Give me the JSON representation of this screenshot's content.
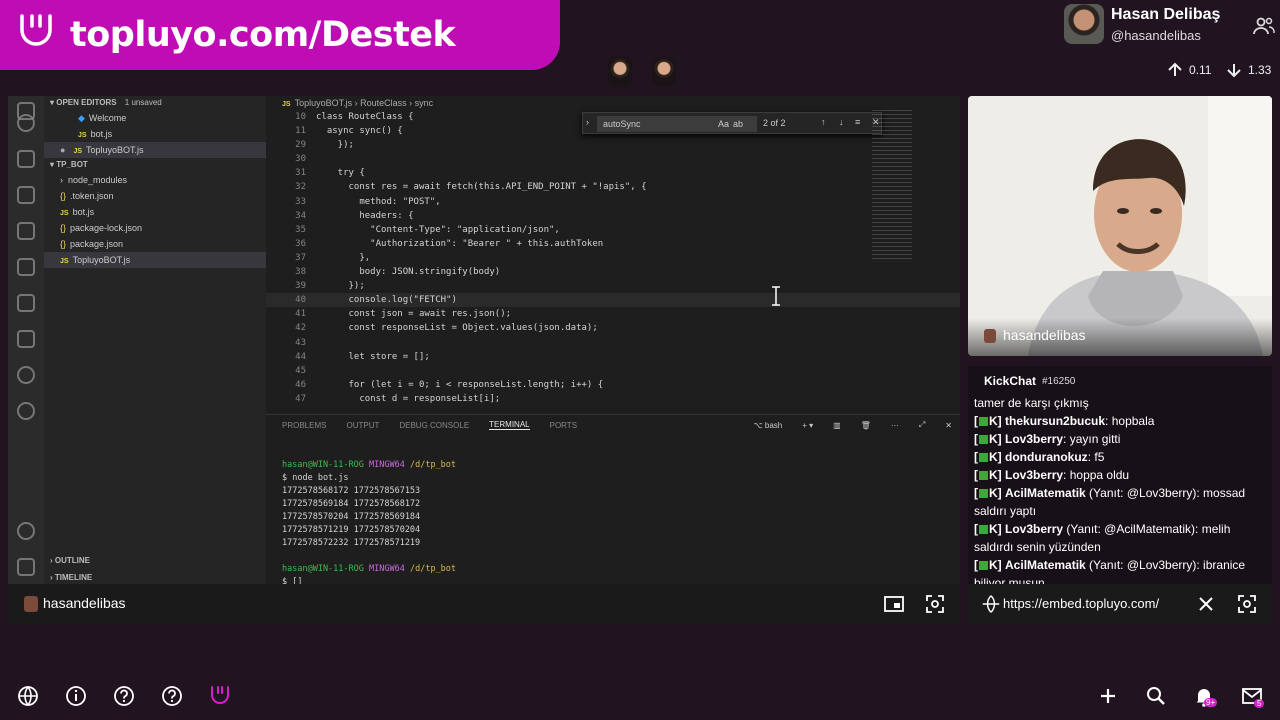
{
  "banner": {
    "text": "topluyo.com/Destek",
    "color": "#c00cb4"
  },
  "profile": {
    "name": "Hasan Delibaş",
    "handle": "@hasandelibas",
    "up": "0.11",
    "down": "1.33"
  },
  "vscode": {
    "explorer": {
      "open_editors_label": "OPEN EDITORS",
      "unsaved": "1 unsaved",
      "open_items": [
        "Welcome",
        "bot.js",
        "TopluyoBOT.js"
      ],
      "folder": "TP_BOT",
      "files": [
        "node_modules",
        ".token.json",
        "bot.js",
        "package-lock.json",
        "package.json",
        "TopluyoBOT.js"
      ],
      "outline": "OUTLINE",
      "timeline": "TIMELINE"
    },
    "breadcrumb": [
      "TopluyoBOT.js",
      "RouteClass",
      "sync"
    ],
    "find": {
      "query": "autoSync",
      "case": "Aa",
      "word": "ab",
      "count": "2 of 2"
    },
    "code": [
      {
        "n": "10",
        "t": "class RouteClass {"
      },
      {
        "n": "11",
        "t": "  async sync() {"
      },
      {
        "n": "29",
        "t": "    });"
      },
      {
        "n": "30",
        "t": ""
      },
      {
        "n": "31",
        "t": "    try {"
      },
      {
        "n": "32",
        "t": "      const res = await fetch(this.API_END_POINT + \"!apis\", {"
      },
      {
        "n": "33",
        "t": "        method: \"POST\","
      },
      {
        "n": "34",
        "t": "        headers: {"
      },
      {
        "n": "35",
        "t": "          \"Content-Type\": \"application/json\","
      },
      {
        "n": "36",
        "t": "          \"Authorization\": \"Bearer \" + this.authToken"
      },
      {
        "n": "37",
        "t": "        },"
      },
      {
        "n": "38",
        "t": "        body: JSON.stringify(body)"
      },
      {
        "n": "39",
        "t": "      });"
      },
      {
        "n": "40",
        "t": "      console.log(\"FETCH\")"
      },
      {
        "n": "41",
        "t": "      const json = await res.json();"
      },
      {
        "n": "42",
        "t": "      const responseList = Object.values(json.data);"
      },
      {
        "n": "43",
        "t": ""
      },
      {
        "n": "44",
        "t": "      let store = [];"
      },
      {
        "n": "45",
        "t": ""
      },
      {
        "n": "46",
        "t": "      for (let i = 0; i < responseList.length; i++) {"
      },
      {
        "n": "47",
        "t": "        const d = responseList[i];"
      }
    ],
    "panel_tabs": [
      "PROBLEMS",
      "OUTPUT",
      "DEBUG CONSOLE",
      "TERMINAL",
      "PORTS"
    ],
    "terminal_shell": "bash",
    "terminal": {
      "prompt_user": "hasan@WIN-11-ROG",
      "prompt_shell": "MINGW64",
      "prompt_path": "/d/tp_bot",
      "command": "$ node bot.js",
      "output": [
        "1772578568172 1772578567153",
        "1772578569184 1772578568172",
        "1772578570204 1772578569184",
        "1772578571219 1772578570204",
        "1772578572232 1772578571219"
      ],
      "last_prompt": "$ []"
    }
  },
  "stream": {
    "streamer": "hasandelibas"
  },
  "webcam": {
    "name": "hasandelibas"
  },
  "chat": {
    "title": "KickChat",
    "count": "#16250",
    "messages": [
      {
        "pre": "",
        "user": "",
        "reply": "",
        "text": "tamer de karşı çıkmış"
      },
      {
        "pre": "[",
        "tag": "K]",
        "user": "thekursun2bucuk",
        "reply": "",
        "text": ": hopbala"
      },
      {
        "pre": "[",
        "tag": "K]",
        "user": "Lov3berry",
        "reply": "",
        "text": ": yayın gitti"
      },
      {
        "pre": "[",
        "tag": "K]",
        "user": "donduranokuz",
        "reply": "",
        "text": ": f5"
      },
      {
        "pre": "[",
        "tag": "K]",
        "user": "Lov3berry",
        "reply": "",
        "text": ": hoppa oldu"
      },
      {
        "pre": "[",
        "tag": "K]",
        "user": "AcilMatematik",
        "reply": " (Yanıt: @Lov3berry)",
        "text": ": mossad saldırı yaptı"
      },
      {
        "pre": "[",
        "tag": "K]",
        "user": "Lov3berry",
        "reply": " (Yanıt: @AcilMatematik)",
        "text": ": melih saldırdı senin yüzünden"
      },
      {
        "pre": "[",
        "tag": "K]",
        "user": "AcilMatematik",
        "reply": " (Yanıt: @Lov3berry)",
        "text": ": ibranice biliyor musun"
      }
    ],
    "url": "https://embed.topluyo.com/"
  },
  "bottom": {
    "notif_badge": "9+",
    "mail_badge": "5"
  }
}
